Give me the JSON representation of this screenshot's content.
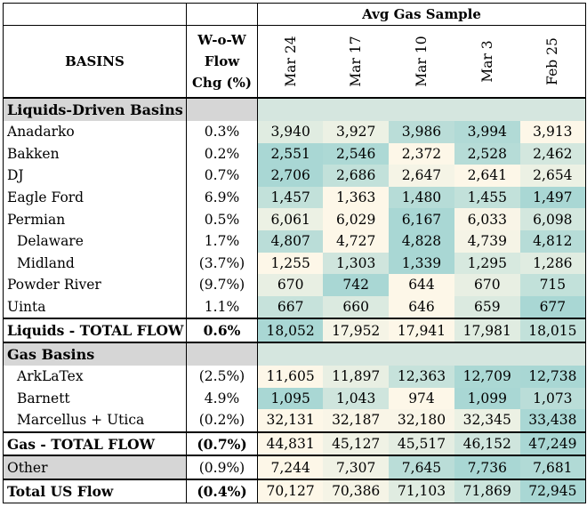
{
  "header": {
    "group_title": "Avg Gas Sample",
    "col_basins": "BASINS",
    "col_wow": [
      "W-o-W",
      "Flow",
      "Chg (%)"
    ],
    "dates": [
      "Mar 24",
      "Mar 17",
      "Mar 10",
      "Mar 3",
      "Feb 25"
    ]
  },
  "colors": {
    "low": "#fdf7e8",
    "high": "#a9d7d4",
    "section_grey": "#d6d6d6",
    "section_fill": "#d5e6df"
  },
  "rows": [
    {
      "type": "section",
      "label": "Liquids-Driven Basins"
    },
    {
      "type": "data",
      "name": "Anadarko",
      "chg": "0.3%",
      "values": [
        "3,940",
        "3,927",
        "3,986",
        "3,994",
        "3,913"
      ],
      "shade": [
        0.35,
        0.2,
        0.8,
        0.9,
        0.0
      ]
    },
    {
      "type": "data",
      "name": "Bakken",
      "chg": "0.2%",
      "values": [
        "2,551",
        "2,546",
        "2,372",
        "2,528",
        "2,462"
      ],
      "shade": [
        1.0,
        0.95,
        0.0,
        0.85,
        0.5
      ]
    },
    {
      "type": "data",
      "name": "DJ",
      "chg": "0.7%",
      "values": [
        "2,706",
        "2,686",
        "2,647",
        "2,641",
        "2,654"
      ],
      "shade": [
        1.0,
        0.7,
        0.1,
        0.0,
        0.2
      ]
    },
    {
      "type": "data",
      "name": "Eagle Ford",
      "chg": "6.9%",
      "values": [
        "1,457",
        "1,363",
        "1,480",
        "1,455",
        "1,497"
      ],
      "shade": [
        0.7,
        0.0,
        0.85,
        0.7,
        1.0
      ]
    },
    {
      "type": "data",
      "name": "Permian",
      "chg": "0.5%",
      "values": [
        "6,061",
        "6,029",
        "6,167",
        "6,033",
        "6,098"
      ],
      "shade": [
        0.2,
        0.0,
        1.0,
        0.05,
        0.5
      ]
    },
    {
      "type": "data",
      "name": "Delaware",
      "indent": true,
      "chg": "1.7%",
      "values": [
        "4,807",
        "4,727",
        "4,828",
        "4,739",
        "4,812"
      ],
      "shade": [
        0.8,
        0.0,
        1.0,
        0.1,
        0.85
      ]
    },
    {
      "type": "data",
      "name": "Midland",
      "indent": true,
      "chg": "(3.7%)",
      "values": [
        "1,255",
        "1,303",
        "1,339",
        "1,295",
        "1,286"
      ],
      "shade": [
        0.0,
        0.55,
        1.0,
        0.45,
        0.35
      ]
    },
    {
      "type": "data",
      "name": "Powder River",
      "chg": "(9.7%)",
      "values": [
        "670",
        "742",
        "644",
        "670",
        "715"
      ],
      "shade": [
        0.25,
        1.0,
        0.0,
        0.25,
        0.7
      ]
    },
    {
      "type": "data",
      "name": "Uinta",
      "chg": "1.1%",
      "values": [
        "667",
        "660",
        "646",
        "659",
        "677"
      ],
      "shade": [
        0.65,
        0.4,
        0.0,
        0.4,
        1.0
      ]
    },
    {
      "type": "total",
      "name": "Liquids - TOTAL FLOW",
      "chg": "0.6%",
      "values": [
        "18,052",
        "17,952",
        "17,941",
        "17,981",
        "18,015"
      ],
      "shade": [
        1.0,
        0.1,
        0.0,
        0.35,
        0.7
      ]
    },
    {
      "type": "section",
      "label": "Gas Basins"
    },
    {
      "type": "data",
      "name": "ArkLaTex",
      "indent": true,
      "chg": "(2.5%)",
      "values": [
        "11,605",
        "11,897",
        "12,363",
        "12,709",
        "12,738"
      ],
      "shade": [
        0.0,
        0.25,
        0.65,
        0.98,
        1.0
      ]
    },
    {
      "type": "data",
      "name": "Barnett",
      "indent": true,
      "chg": "4.9%",
      "values": [
        "1,095",
        "1,043",
        "974",
        "1,099",
        "1,073"
      ],
      "shade": [
        1.0,
        0.55,
        0.0,
        1.0,
        0.8
      ]
    },
    {
      "type": "data",
      "name": "Marcellus + Utica",
      "indent": true,
      "chg": "(0.2%)",
      "values": [
        "32,131",
        "32,187",
        "32,180",
        "32,345",
        "33,438"
      ],
      "shade": [
        0.0,
        0.05,
        0.05,
        0.2,
        1.0
      ]
    },
    {
      "type": "total",
      "name": "Gas - TOTAL FLOW",
      "chg": "(0.7%)",
      "values": [
        "44,831",
        "45,127",
        "45,517",
        "46,152",
        "47,249"
      ],
      "shade": [
        0.0,
        0.15,
        0.3,
        0.55,
        1.0
      ]
    },
    {
      "type": "other",
      "name": "Other",
      "chg": "(0.9%)",
      "values": [
        "7,244",
        "7,307",
        "7,645",
        "7,736",
        "7,681"
      ],
      "shade": [
        0.0,
        0.15,
        0.8,
        1.0,
        0.9
      ]
    },
    {
      "type": "total",
      "name": "Total US Flow",
      "chg": "(0.4%)",
      "values": [
        "70,127",
        "70,386",
        "71,103",
        "71,869",
        "72,945"
      ],
      "shade": [
        0.0,
        0.1,
        0.35,
        0.6,
        1.0
      ]
    }
  ]
}
